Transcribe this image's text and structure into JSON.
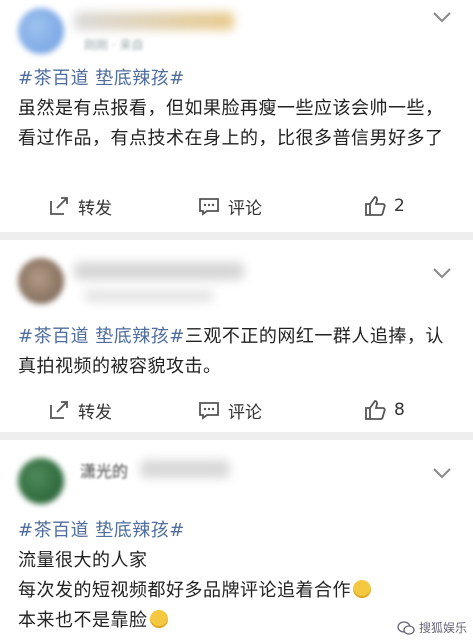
{
  "posts": [
    {
      "hashtags": "#茶百道 垫底辣孩#",
      "text": "虽然是有点报看，但如果脸再瘦一些应该会帅一些，看过作品，有点技术在身上的，比很多普信男好多了",
      "meta": "刚刚 · 来自",
      "repost_label": "转发",
      "comment_label": "评论",
      "like_count": "2"
    },
    {
      "hashtags": "#茶百道 垫底辣孩#",
      "text": "三观不正的网红一群人追捧，认真拍视频的被容貌攻击。",
      "repost_label": "转发",
      "comment_label": "评论",
      "like_count": "8"
    },
    {
      "name": "潇光的",
      "hashtags": "#茶百道 垫底辣孩#",
      "line1": "流量很大的人家",
      "line2": "每次发的短视频都好多品牌评论追着合作",
      "line3": "本来也不是靠脸"
    }
  ],
  "watermark": "搜狐娱乐",
  "colors": {
    "link": "#4f6e9e",
    "background": "#eeeeee",
    "card": "#ffffff"
  }
}
